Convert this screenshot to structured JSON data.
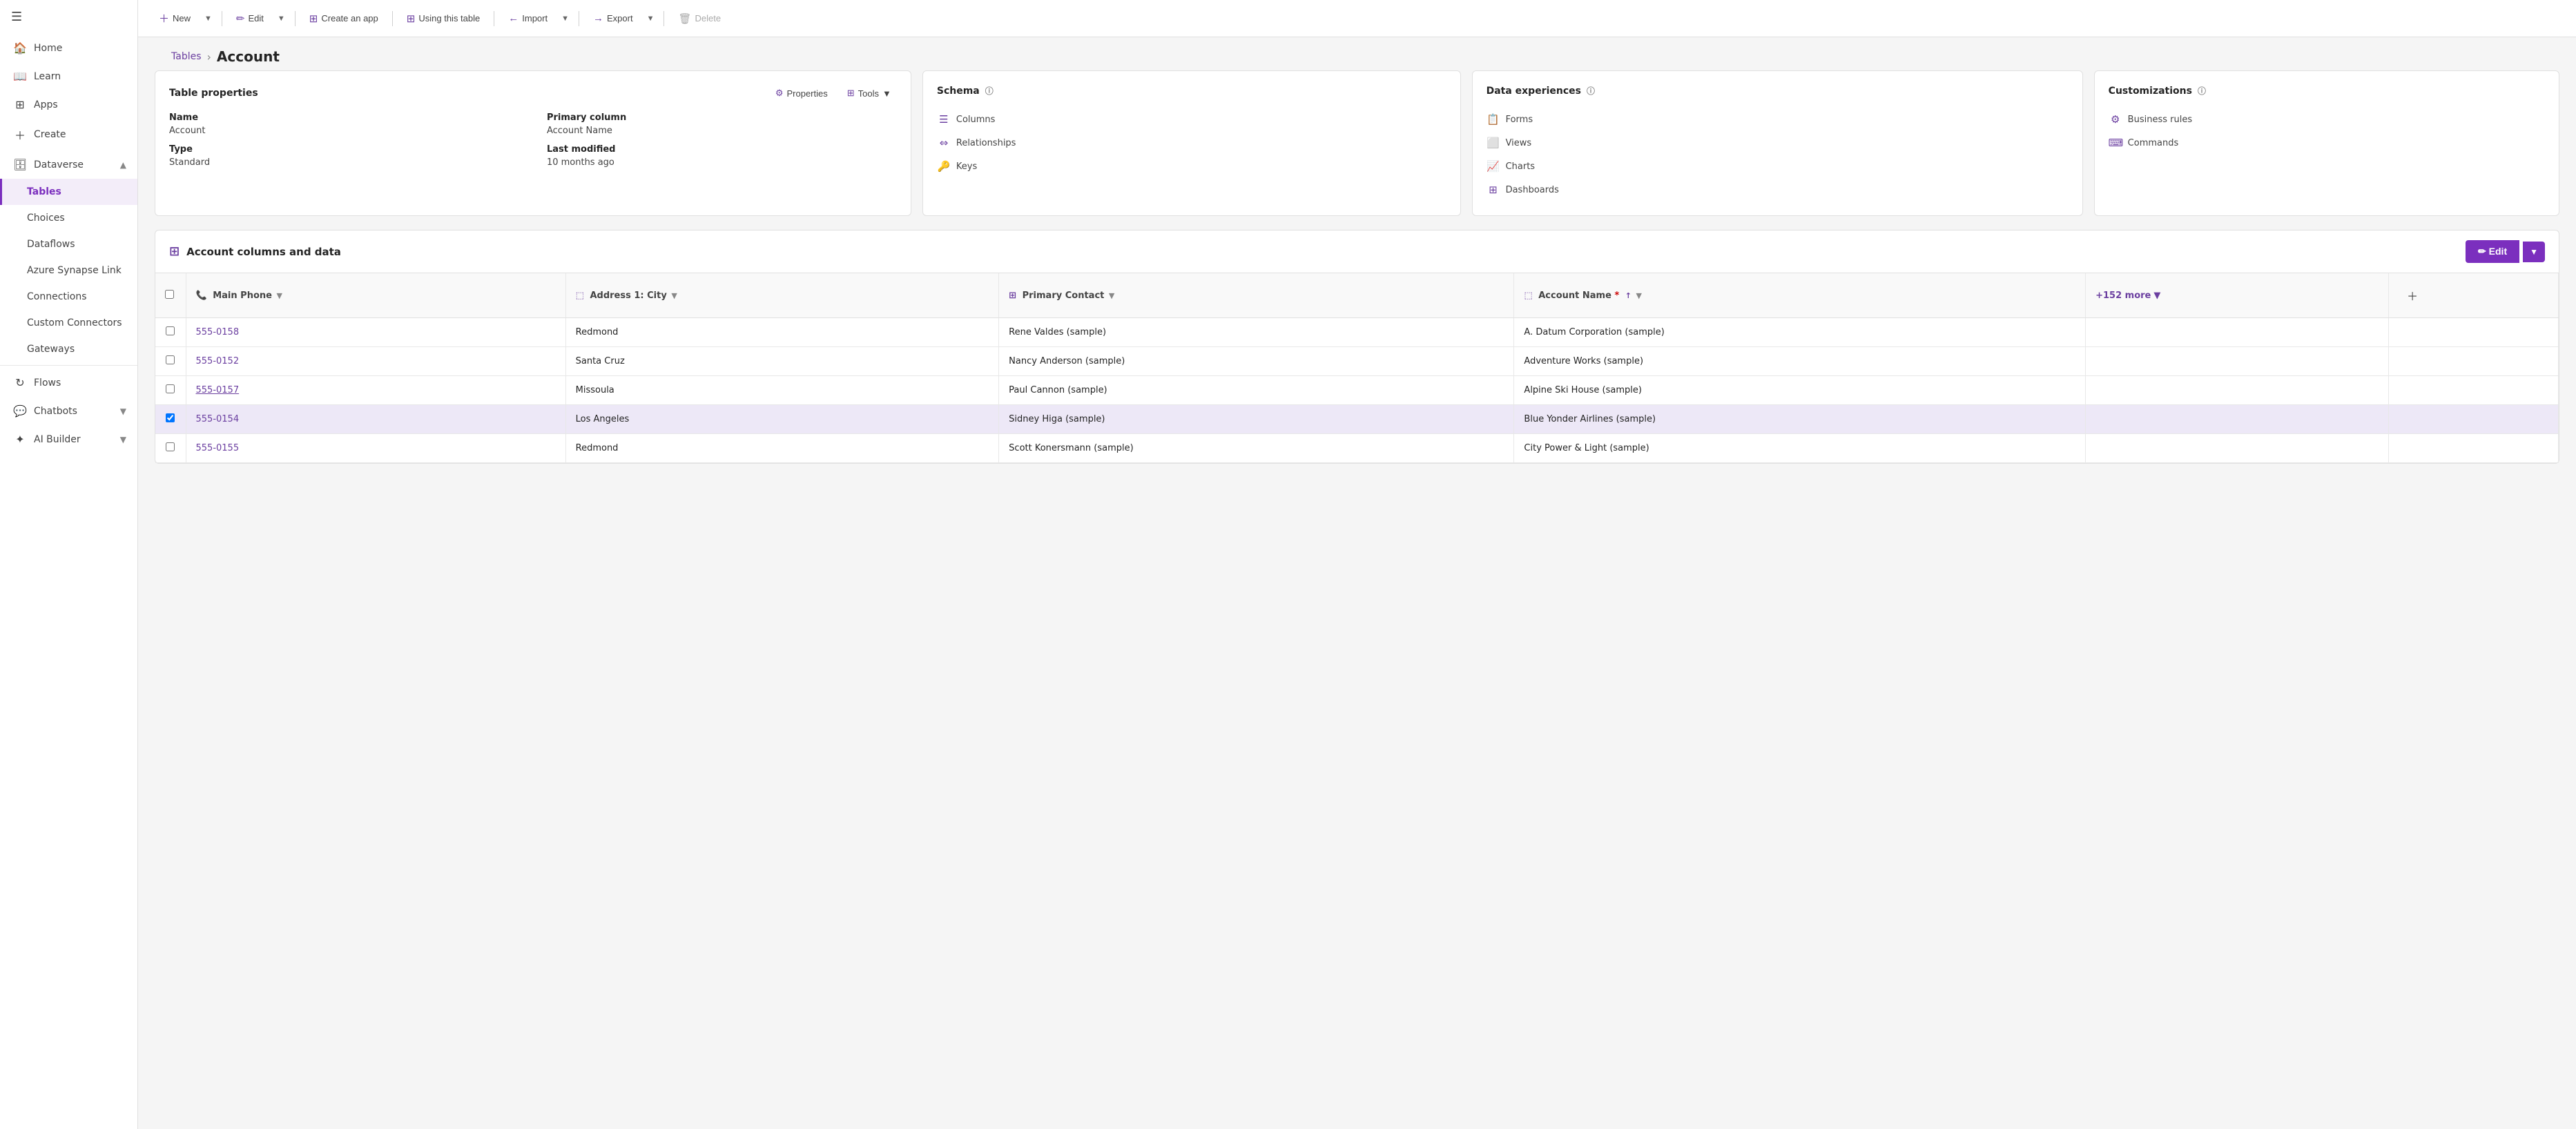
{
  "sidebar": {
    "hamburger_icon": "☰",
    "items": [
      {
        "id": "home",
        "label": "Home",
        "icon": "🏠",
        "indent": false,
        "active": false,
        "interactable": true
      },
      {
        "id": "learn",
        "label": "Learn",
        "icon": "📖",
        "indent": false,
        "active": false,
        "interactable": true
      },
      {
        "id": "apps",
        "label": "Apps",
        "icon": "⊞",
        "indent": false,
        "active": false,
        "interactable": true
      },
      {
        "id": "create",
        "label": "Create",
        "icon": "+",
        "indent": false,
        "active": false,
        "interactable": true
      },
      {
        "id": "dataverse",
        "label": "Dataverse",
        "icon": "🗄",
        "indent": false,
        "active": false,
        "interactable": true,
        "expand": "▲"
      },
      {
        "id": "tables",
        "label": "Tables",
        "icon": "",
        "indent": true,
        "active": true,
        "interactable": true
      },
      {
        "id": "choices",
        "label": "Choices",
        "icon": "",
        "indent": true,
        "active": false,
        "interactable": true
      },
      {
        "id": "dataflows",
        "label": "Dataflows",
        "icon": "",
        "indent": true,
        "active": false,
        "interactable": true
      },
      {
        "id": "azure-synapse",
        "label": "Azure Synapse Link",
        "icon": "",
        "indent": true,
        "active": false,
        "interactable": true
      },
      {
        "id": "connections",
        "label": "Connections",
        "icon": "",
        "indent": true,
        "active": false,
        "interactable": true
      },
      {
        "id": "custom-connectors",
        "label": "Custom Connectors",
        "icon": "",
        "indent": true,
        "active": false,
        "interactable": true
      },
      {
        "id": "gateways",
        "label": "Gateways",
        "icon": "",
        "indent": true,
        "active": false,
        "interactable": true
      },
      {
        "id": "flows",
        "label": "Flows",
        "icon": "↻",
        "indent": false,
        "active": false,
        "interactable": true
      },
      {
        "id": "chatbots",
        "label": "Chatbots",
        "icon": "💬",
        "indent": false,
        "active": false,
        "interactable": true,
        "expand": "▼"
      },
      {
        "id": "ai-builder",
        "label": "AI Builder",
        "icon": "✦",
        "indent": false,
        "active": false,
        "interactable": true,
        "expand": "▼"
      }
    ]
  },
  "toolbar": {
    "new_label": "New",
    "edit_label": "Edit",
    "create_app_label": "Create an app",
    "using_table_label": "Using this table",
    "import_label": "Import",
    "export_label": "Export",
    "delete_label": "Delete"
  },
  "breadcrumb": {
    "tables_label": "Tables",
    "separator": "›",
    "current": "Account"
  },
  "table_properties_card": {
    "title": "Table properties",
    "properties_btn": "Properties",
    "tools_btn": "Tools",
    "name_label": "Name",
    "name_value": "Account",
    "type_label": "Type",
    "type_value": "Standard",
    "primary_column_label": "Primary column",
    "primary_column_value": "Account Name",
    "last_modified_label": "Last modified",
    "last_modified_value": "10 months ago"
  },
  "schema_card": {
    "title": "Schema",
    "info_icon": "ⓘ",
    "links": [
      {
        "id": "columns",
        "label": "Columns",
        "icon": "☰"
      },
      {
        "id": "relationships",
        "label": "Relationships",
        "icon": "⇔"
      },
      {
        "id": "keys",
        "label": "Keys",
        "icon": "🔑"
      }
    ]
  },
  "data_experiences_card": {
    "title": "Data experiences",
    "info_icon": "ⓘ",
    "links": [
      {
        "id": "forms",
        "label": "Forms",
        "icon": "📋"
      },
      {
        "id": "views",
        "label": "Views",
        "icon": "⬜"
      },
      {
        "id": "charts",
        "label": "Charts",
        "icon": "📈"
      },
      {
        "id": "dashboards",
        "label": "Dashboards",
        "icon": "⊞"
      }
    ]
  },
  "customizations_card": {
    "title": "Customizations",
    "info_icon": "ⓘ",
    "links": [
      {
        "id": "business-rules",
        "label": "Business rules",
        "icon": "⚙"
      },
      {
        "id": "commands",
        "label": "Commands",
        "icon": "⌨"
      }
    ]
  },
  "account_table": {
    "section_title": "Account columns and data",
    "section_icon": "⊞",
    "edit_btn_label": "✏ Edit",
    "edit_chevron": "▼",
    "columns": [
      {
        "id": "main-phone",
        "label": "Main Phone",
        "icon": "📞",
        "sortable": true
      },
      {
        "id": "address-city",
        "label": "Address 1: City",
        "icon": "⬚",
        "sortable": true
      },
      {
        "id": "primary-contact",
        "label": "Primary Contact",
        "icon": "⊞",
        "sortable": true
      },
      {
        "id": "account-name",
        "label": "Account Name",
        "icon": "⬚",
        "required": true,
        "sortable": true,
        "sorted": "↑"
      }
    ],
    "more_col": "+152 more",
    "rows": [
      {
        "id": "row1",
        "main_phone": "555-0158",
        "address_city": "Redmond",
        "primary_contact": "Rene Valdes (sample)",
        "account_name": "A. Datum Corporation (sample)",
        "selected": false
      },
      {
        "id": "row2",
        "main_phone": "555-0152",
        "address_city": "Santa Cruz",
        "primary_contact": "Nancy Anderson (sample)",
        "account_name": "Adventure Works (sample)",
        "selected": false
      },
      {
        "id": "row3",
        "main_phone": "555-0157",
        "address_city": "Missoula",
        "primary_contact": "Paul Cannon (sample)",
        "account_name": "Alpine Ski House (sample)",
        "selected": false
      },
      {
        "id": "row4",
        "main_phone": "555-0154",
        "address_city": "Los Angeles",
        "primary_contact": "Sidney Higa (sample)",
        "account_name": "Blue Yonder Airlines (sample)",
        "selected": true
      },
      {
        "id": "row5",
        "main_phone": "555-0155",
        "address_city": "Redmond",
        "primary_contact": "Scott Konersmann (sample)",
        "account_name": "City Power & Light (sample)",
        "selected": false
      }
    ]
  },
  "colors": {
    "accent": "#7B2FBE",
    "accent_light": "#f3edf9",
    "border": "#e0e0e0",
    "text_primary": "#242424",
    "text_secondary": "#444",
    "text_muted": "#888"
  }
}
